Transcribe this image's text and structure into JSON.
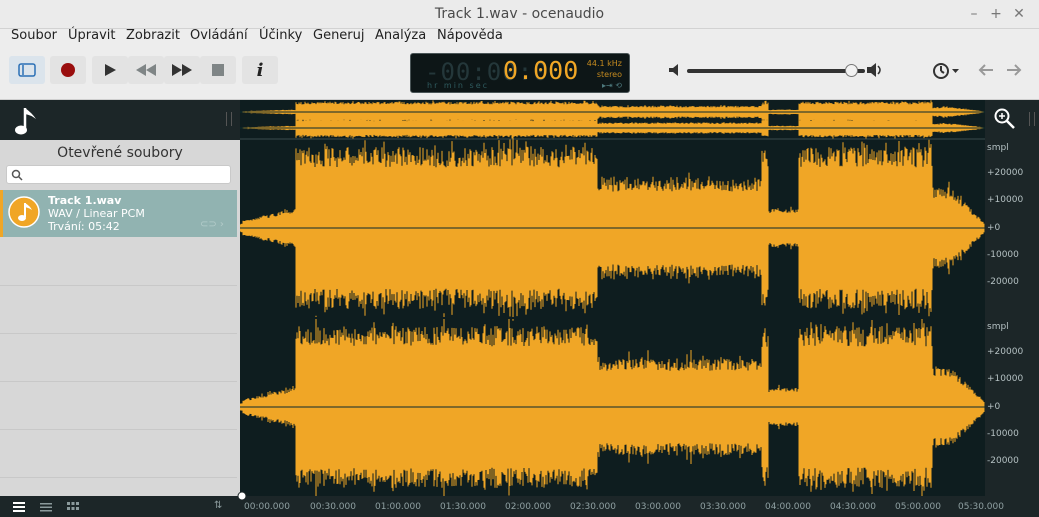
{
  "window": {
    "title": "Track 1.wav - ocenaudio"
  },
  "menu": [
    "Soubor",
    "Úpravit",
    "Zobrazit",
    "Ovládání",
    "Účinky",
    "Generuj",
    "Analýza",
    "Nápověda"
  ],
  "display": {
    "time_dim": "-00:00:0",
    "time_lit": "0.000",
    "units": "hr   min  sec",
    "rate": "44.1 kHz",
    "channels": "stereo"
  },
  "sidebar": {
    "title": "Otevřené soubory",
    "search_placeholder": "",
    "files": [
      {
        "name": "Track 1.wav",
        "format": "WAV / Linear PCM",
        "duration": "Trvání: 05:42"
      }
    ]
  },
  "volume": {
    "level": 0.92
  },
  "ruler": {
    "unit": "smpl",
    "ticks": [
      "+20000",
      "+10000",
      "+0",
      "-10000",
      "-20000"
    ]
  },
  "timeline": {
    "ticks": [
      "00:00.000",
      "00:30.000",
      "01:00.000",
      "01:30.000",
      "02:00.000",
      "02:30.000",
      "03:00.000",
      "03:30.000",
      "04:00.000",
      "04:30.000",
      "05:00.000",
      "05:30.000"
    ]
  },
  "colors": {
    "waveform": "#f0a626",
    "background": "#0e1d1f",
    "selection": "#91b3b1"
  },
  "icons": {
    "sidebar_toggle": "sidebar-toggle-icon",
    "record": "record-icon",
    "play": "play-icon",
    "rewind": "rewind-icon",
    "forward": "fast-forward-icon",
    "stop": "stop-icon",
    "info": "info-icon",
    "zoom": "zoom-in-icon",
    "history": "clock-icon"
  }
}
